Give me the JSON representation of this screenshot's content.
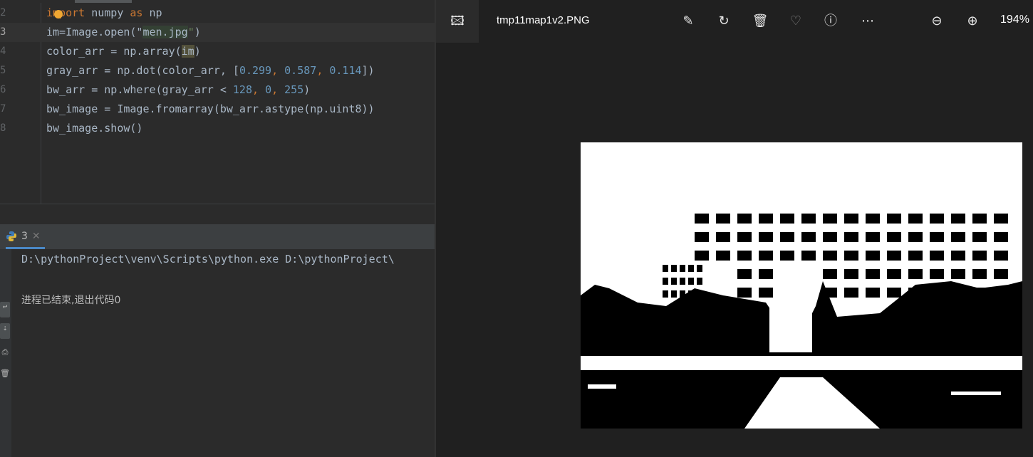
{
  "editor": {
    "lines": [
      {
        "n": "2",
        "parts": [
          [
            "kw",
            "import"
          ],
          [
            "t",
            " numpy "
          ],
          [
            "kw",
            "as"
          ],
          [
            "t",
            " np"
          ]
        ]
      },
      {
        "n": "3",
        "parts": [
          [
            "t",
            "im=Image.open(\""
          ],
          [
            "strbg",
            "men.jpg"
          ],
          [
            "str",
            "\""
          ],
          [
            "t",
            ")"
          ]
        ]
      },
      {
        "n": "4",
        "parts": [
          [
            "t",
            "color_arr = np.array("
          ],
          [
            "hl",
            "im"
          ],
          [
            "t",
            ")"
          ]
        ]
      },
      {
        "n": "5",
        "parts": [
          [
            "t",
            "gray_arr = np.dot(color_arr, ["
          ],
          [
            "num",
            "0.299"
          ],
          [
            "kw",
            ", "
          ],
          [
            "num",
            "0.587"
          ],
          [
            "kw",
            ", "
          ],
          [
            "num",
            "0.114"
          ],
          [
            "t",
            "])"
          ]
        ]
      },
      {
        "n": "6",
        "parts": [
          [
            "t",
            "bw_arr = np.where(gray_arr < "
          ],
          [
            "num",
            "128"
          ],
          [
            "kw",
            ", "
          ],
          [
            "num",
            "0"
          ],
          [
            "kw",
            ", "
          ],
          [
            "num",
            "255"
          ],
          [
            "t",
            ")"
          ]
        ]
      },
      {
        "n": "7",
        "parts": [
          [
            "t",
            "bw_image = Image.fromarray(bw_arr.astype(np.uint8))"
          ]
        ]
      },
      {
        "n": "8",
        "parts": [
          [
            "t",
            "bw_image.show()"
          ]
        ]
      }
    ]
  },
  "run": {
    "tab_label": "3",
    "console": [
      "D:\\pythonProject\\venv\\Scripts\\python.exe D:\\pythonProject\\",
      "进程已结束,退出代码0"
    ]
  },
  "viewer": {
    "filename": "tmp11map1v2.PNG",
    "zoom": "194%",
    "icons": [
      "gallery-icon",
      "edit-icon",
      "rotate-icon",
      "delete-icon",
      "favorite-icon",
      "info-icon",
      "more-icon",
      "zoom-out-icon",
      "zoom-in-icon"
    ]
  }
}
